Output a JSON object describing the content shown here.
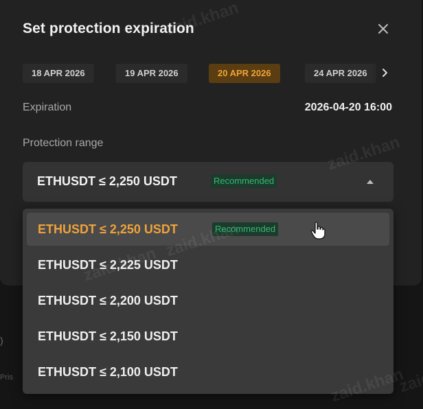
{
  "background": {
    "text_1": ")",
    "text_2": "Pris"
  },
  "dialog": {
    "title": "Set protection expiration",
    "close_icon": "close-icon",
    "date_tabs": [
      {
        "label": "18 APR 2026",
        "active": false
      },
      {
        "label": "19 APR 2026",
        "active": false
      },
      {
        "label": "20 APR 2026",
        "active": true
      },
      {
        "label": "24 APR 2026",
        "active": false
      }
    ],
    "next_icon": "chevron-right-icon",
    "expiration_label": "Expiration",
    "expiration_value": "2026-04-20 16:00",
    "range_label": "Protection range",
    "select": {
      "value": "ETHUSDT ≤ 2,250 USDT",
      "badge": "Recommended",
      "icon": "caret-up-icon"
    },
    "options": [
      {
        "label": "ETHUSDT ≤ 2,250 USDT",
        "badge": "Recommended",
        "selected": true
      },
      {
        "label": "ETHUSDT ≤ 2,225 USDT"
      },
      {
        "label": "ETHUSDT ≤ 2,200 USDT"
      },
      {
        "label": "ETHUSDT ≤ 2,150 USDT"
      },
      {
        "label": "ETHUSDT ≤ 2,100 USDT"
      }
    ]
  },
  "watermarks": [
    "zaid.khan",
    "zaid.khan",
    "zaid.khan",
    "zaid.khan",
    "zaid.khan",
    "zaid.khan"
  ],
  "colors": {
    "accent": "#f0a33b",
    "active_tab_bg": "#5a3d10",
    "badge_green": "#2fbd73",
    "badge_bg": "#1e3a2c",
    "modal_bg": "#222222"
  }
}
